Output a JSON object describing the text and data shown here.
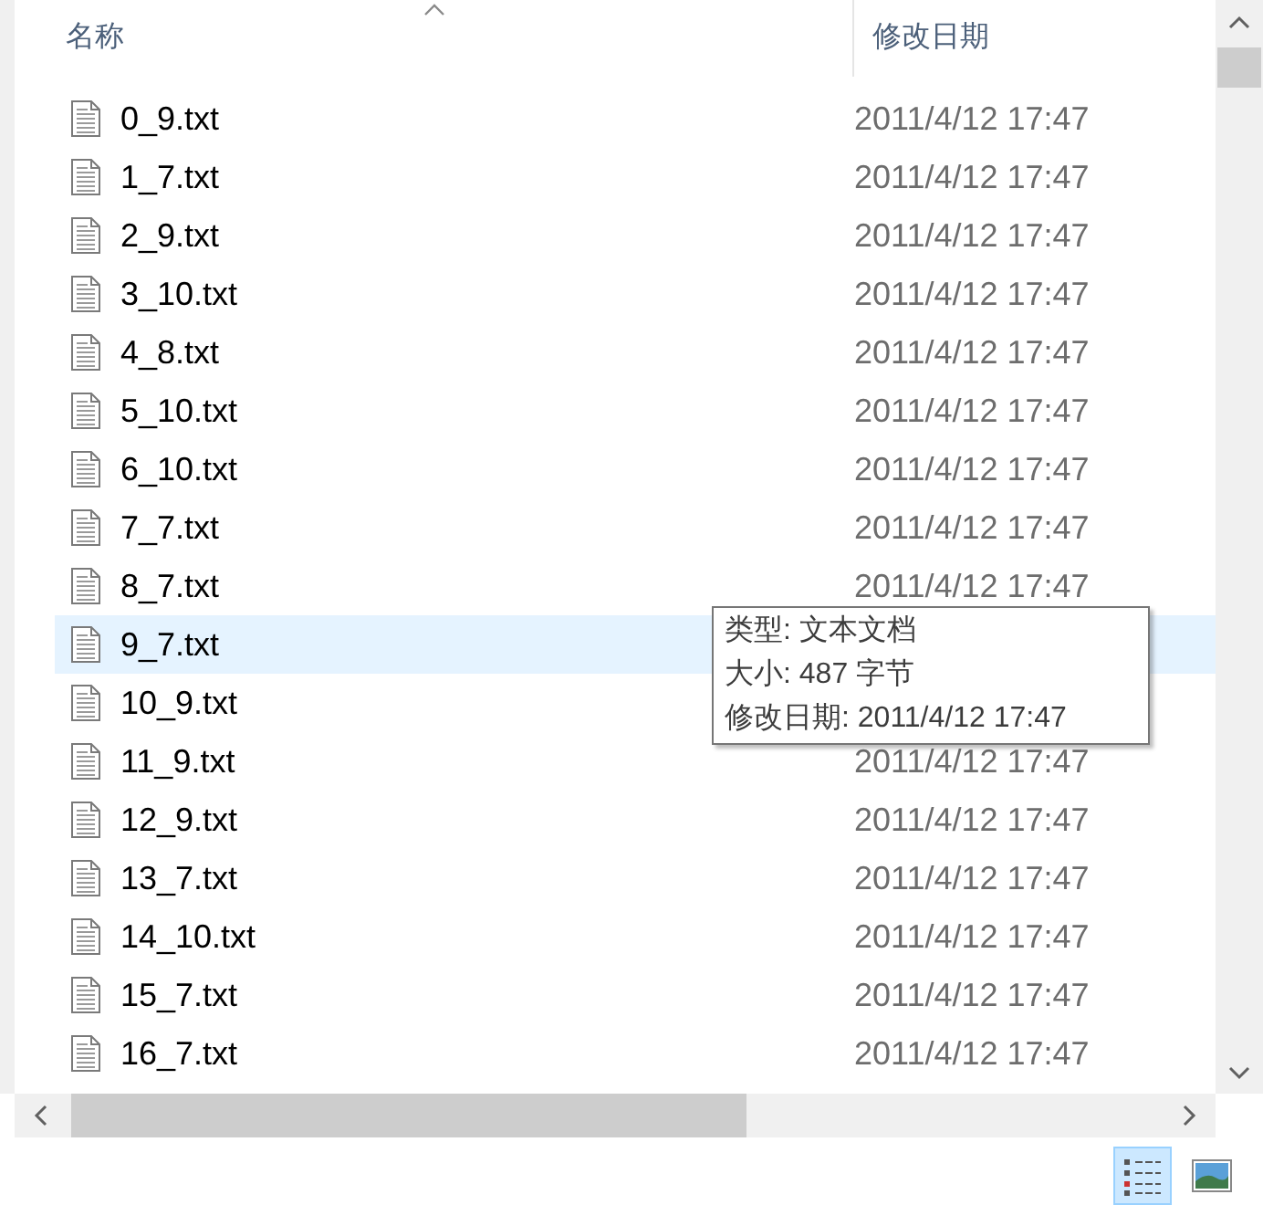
{
  "columns": [
    {
      "label": "名称",
      "sorted": true
    },
    {
      "label": "修改日期",
      "sorted": false
    }
  ],
  "rows": [
    {
      "name": "0_9.txt",
      "date": "2011/4/12 17:47",
      "hovered": false
    },
    {
      "name": "1_7.txt",
      "date": "2011/4/12 17:47",
      "hovered": false
    },
    {
      "name": "2_9.txt",
      "date": "2011/4/12 17:47",
      "hovered": false
    },
    {
      "name": "3_10.txt",
      "date": "2011/4/12 17:47",
      "hovered": false
    },
    {
      "name": "4_8.txt",
      "date": "2011/4/12 17:47",
      "hovered": false
    },
    {
      "name": "5_10.txt",
      "date": "2011/4/12 17:47",
      "hovered": false
    },
    {
      "name": "6_10.txt",
      "date": "2011/4/12 17:47",
      "hovered": false
    },
    {
      "name": "7_7.txt",
      "date": "2011/4/12 17:47",
      "hovered": false
    },
    {
      "name": "8_7.txt",
      "date": "2011/4/12 17:47",
      "hovered": false
    },
    {
      "name": "9_7.txt",
      "hovered": true
    },
    {
      "name": "10_9.txt",
      "hovered": false
    },
    {
      "name": "11_9.txt",
      "date": "2011/4/12 17:47",
      "hovered": false
    },
    {
      "name": "12_9.txt",
      "date": "2011/4/12 17:47",
      "hovered": false
    },
    {
      "name": "13_7.txt",
      "date": "2011/4/12 17:47",
      "hovered": false
    },
    {
      "name": "14_10.txt",
      "date": "2011/4/12 17:47",
      "hovered": false
    },
    {
      "name": "15_7.txt",
      "date": "2011/4/12 17:47",
      "hovered": false
    },
    {
      "name": "16_7.txt",
      "date": "2011/4/12 17:47",
      "hovered": false
    }
  ],
  "tooltip": {
    "lines": [
      "类型: 文本文档",
      "大小: 487 字节",
      "修改日期: 2011/4/12 17:47"
    ]
  },
  "view_buttons": [
    {
      "kind": "details",
      "selected": true
    },
    {
      "kind": "thumbnails",
      "selected": false
    }
  ]
}
